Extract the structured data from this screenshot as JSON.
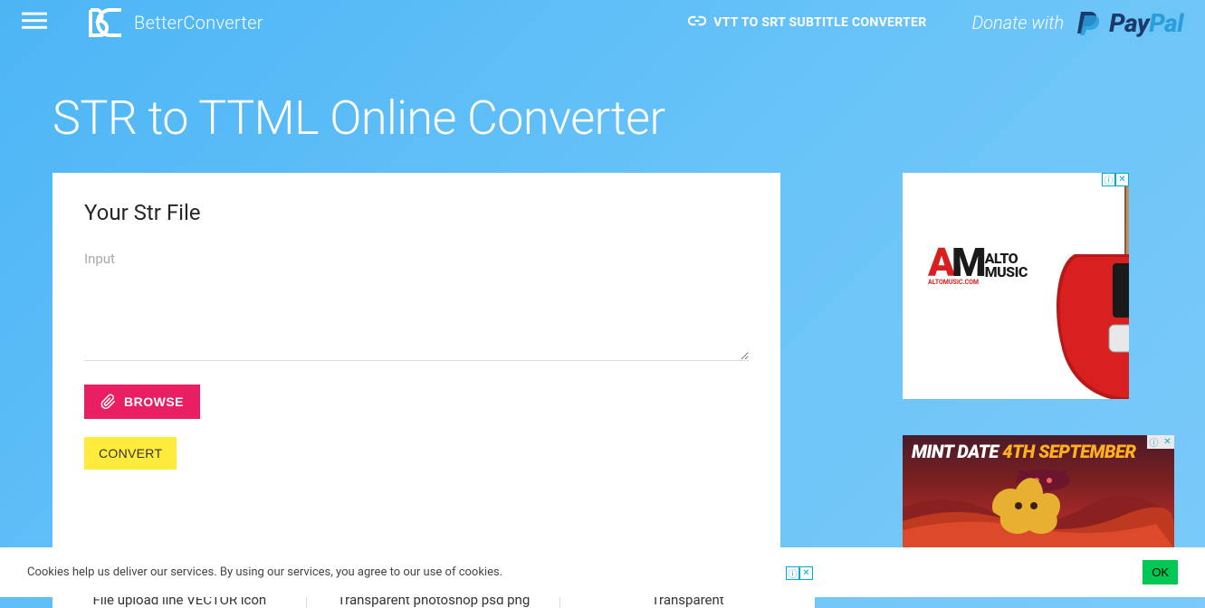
{
  "header": {
    "brand": "BetterConverter",
    "link_label": "VTT TO SRT SUBTITLE CONVERTER",
    "donate_text": "Donate with",
    "paypal_pay": "Pay",
    "paypal_pal": "Pal"
  },
  "page": {
    "title": "STR to TTML Online Converter"
  },
  "card": {
    "title": "Your Str File",
    "input_label": "Input",
    "browse_label": "BROWSE",
    "convert_label": "CONVERT"
  },
  "ad1": {
    "brand_am": "A",
    "brand_m": "M",
    "brand_line1": "ALTO",
    "brand_line2": "MUSIC",
    "brand_url": "ALTOMUSIC.COM"
  },
  "ad2": {
    "line_a": "MINT DATE ",
    "line_b": "4TH SEPTEMBER"
  },
  "ads_strip": {
    "items": [
      "File upload line\nVECTOR icon",
      "Transparent\nphotoshop psd png",
      "Transparent"
    ]
  },
  "cookie": {
    "text": "Cookies help us deliver our services. By using our services, you agree to our use of cookies.",
    "ok": "OK"
  }
}
